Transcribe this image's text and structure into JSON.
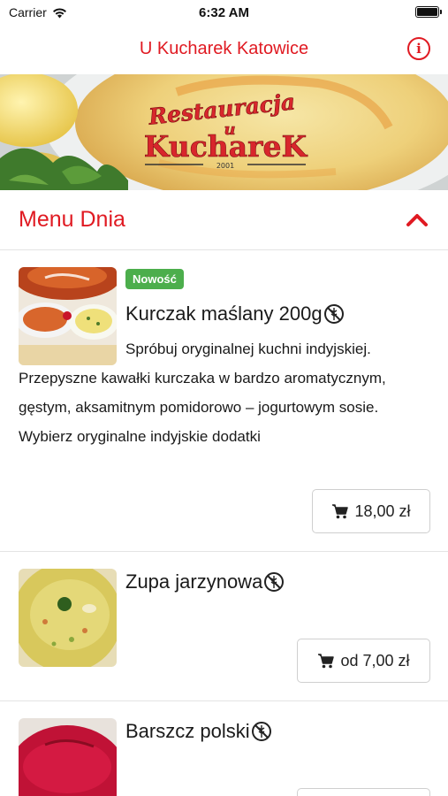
{
  "status_bar": {
    "carrier": "Carrier",
    "time": "6:32 AM"
  },
  "header": {
    "title": "U Kucharek Katowice",
    "info_icon": "info-icon"
  },
  "banner": {
    "logo_line1": "Restauracja",
    "logo_line2": "u",
    "logo_line3": "KuchareK",
    "logo_year": "2001"
  },
  "section": {
    "title": "Menu Dnia",
    "toggle_icon": "chevron-up-icon",
    "expanded": true
  },
  "items": [
    {
      "badge": "Nowość",
      "title": "Kurczak maślany 200g",
      "gluten_free_icon": "no-gluten-icon",
      "description": "Spróbuj oryginalnej kuchni indyjskiej. Przepyszne kawałki kurczaka w bardzo aromatycznym, gęstym, aksamitnym pomidorowo – jogurtowym sosie. Wybierz oryginalne indyjskie dodatki",
      "price": "18,00 zł"
    },
    {
      "title": "Zupa jarzynowa",
      "gluten_free_icon": "no-gluten-icon",
      "price": "od 7,00 zł"
    },
    {
      "title": "Barszcz polski",
      "gluten_free_icon": "no-gluten-icon"
    }
  ],
  "colors": {
    "accent": "#e01a22",
    "badge": "#4cae4c",
    "divider": "#e4e4e4"
  }
}
